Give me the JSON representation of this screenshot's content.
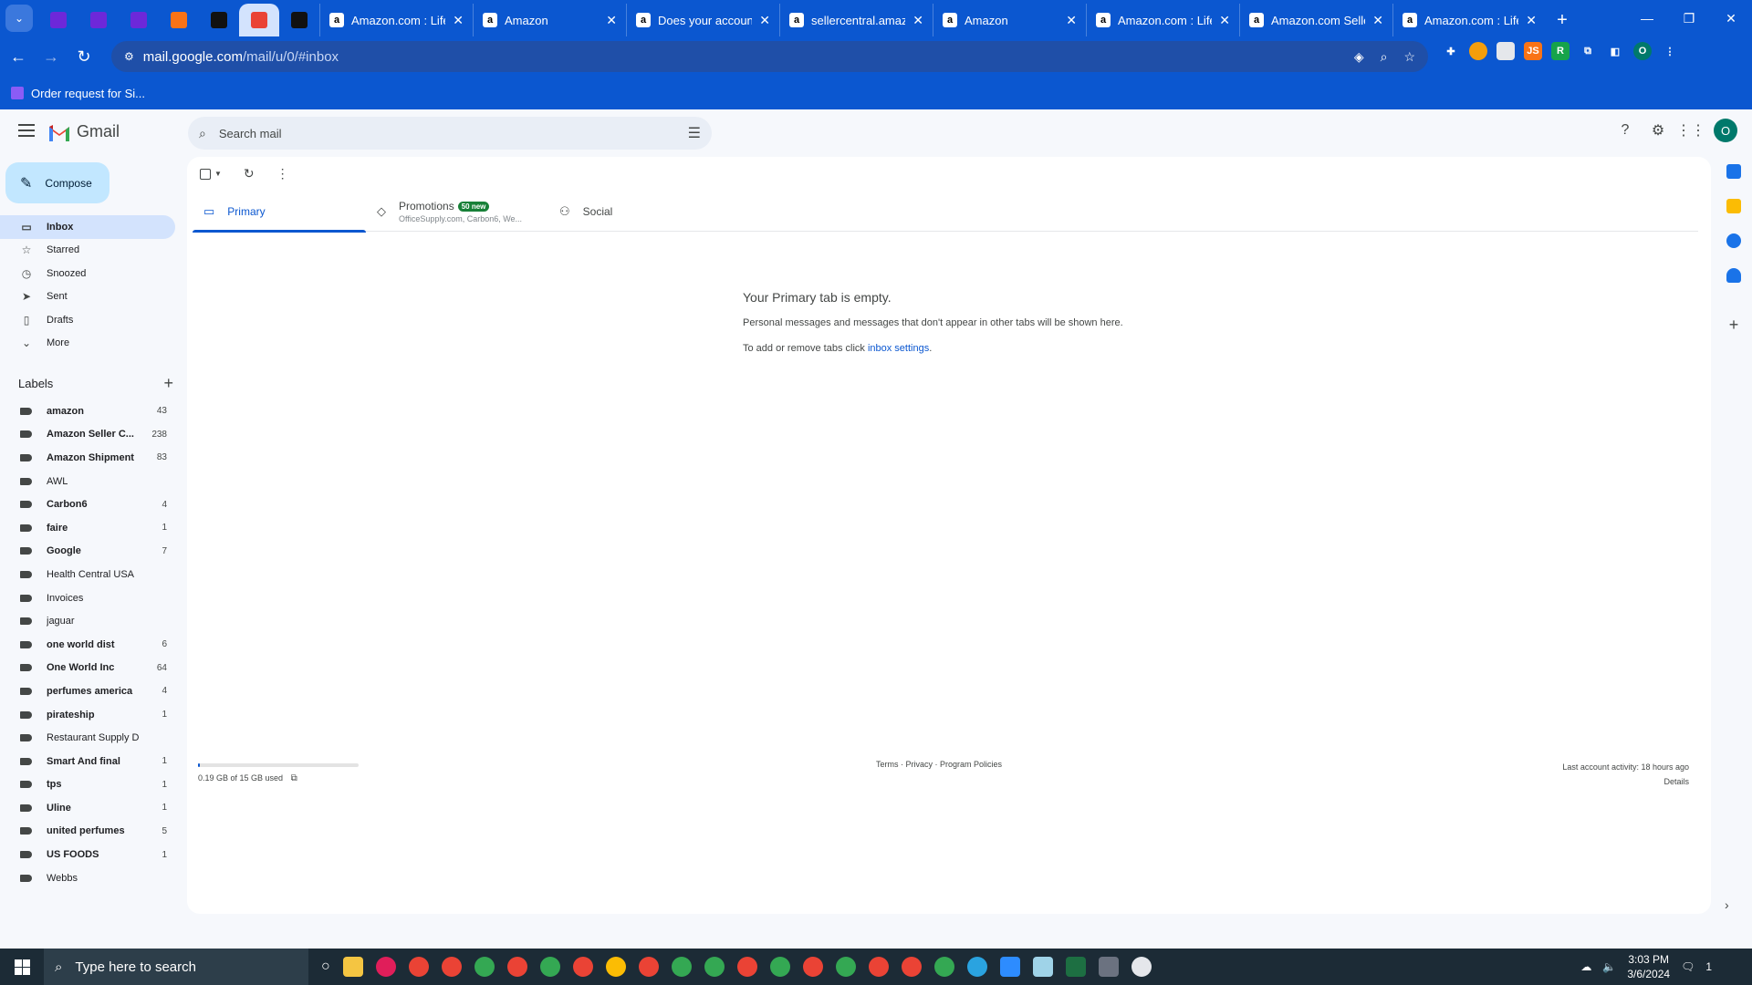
{
  "browser": {
    "pinned_tabs": [
      {
        "name": "purple-app-1",
        "color": "#6d28d9"
      },
      {
        "name": "purple-app-2",
        "color": "#6d28d9"
      },
      {
        "name": "purple-app-3",
        "color": "#6d28d9"
      },
      {
        "name": "clickup",
        "color": "#f97316"
      },
      {
        "name": "amazon",
        "color": "#111111"
      },
      {
        "name": "gmail",
        "color": "#ea4335"
      },
      {
        "name": "amazon",
        "color": "#111111"
      }
    ],
    "tabs": [
      {
        "title": "Amazon.com : Life"
      },
      {
        "title": "Amazon"
      },
      {
        "title": "Does your account"
      },
      {
        "title": "sellercentral.amaz"
      },
      {
        "title": "Amazon"
      },
      {
        "title": "Amazon.com : Life"
      },
      {
        "title": "Amazon.com Selle"
      },
      {
        "title": "Amazon.com : Life"
      }
    ],
    "url_host": "mail.google.com",
    "url_path": "/mail/u/0/#inbox",
    "bookmark": "Order request for Si..."
  },
  "gmail": {
    "logo_text": "Gmail",
    "search_placeholder": "Search mail",
    "avatar_letter": "O",
    "compose_label": "Compose",
    "nav": [
      {
        "label": "Inbox",
        "icon": "inbox-icon",
        "glyph": "▭",
        "active": true
      },
      {
        "label": "Starred",
        "icon": "star-icon",
        "glyph": "☆"
      },
      {
        "label": "Snoozed",
        "icon": "clock-icon",
        "glyph": "◷"
      },
      {
        "label": "Sent",
        "icon": "send-icon",
        "glyph": "➤"
      },
      {
        "label": "Drafts",
        "icon": "draft-icon",
        "glyph": "▯"
      },
      {
        "label": "More",
        "icon": "chevron-down-icon",
        "glyph": "⌄"
      }
    ],
    "labels_heading": "Labels",
    "labels": [
      {
        "name": "amazon",
        "count": "43",
        "bold": true
      },
      {
        "name": "Amazon Seller C...",
        "count": "238",
        "bold": true
      },
      {
        "name": "Amazon Shipment",
        "count": "83",
        "bold": true
      },
      {
        "name": "AWL",
        "count": "",
        "bold": false
      },
      {
        "name": "Carbon6",
        "count": "4",
        "bold": true
      },
      {
        "name": "faire",
        "count": "1",
        "bold": true
      },
      {
        "name": "Google",
        "count": "7",
        "bold": true
      },
      {
        "name": "Health Central USA",
        "count": "",
        "bold": false
      },
      {
        "name": "Invoices",
        "count": "",
        "bold": false
      },
      {
        "name": "jaguar",
        "count": "",
        "bold": false
      },
      {
        "name": "one world dist",
        "count": "6",
        "bold": true
      },
      {
        "name": "One World Inc",
        "count": "64",
        "bold": true
      },
      {
        "name": "perfumes america",
        "count": "4",
        "bold": true
      },
      {
        "name": "pirateship",
        "count": "1",
        "bold": true
      },
      {
        "name": "Restaurant Supply D",
        "count": "",
        "bold": false
      },
      {
        "name": "Smart And final",
        "count": "1",
        "bold": true
      },
      {
        "name": "tps",
        "count": "1",
        "bold": true
      },
      {
        "name": "Uline",
        "count": "1",
        "bold": true
      },
      {
        "name": "united perfumes",
        "count": "5",
        "bold": true
      },
      {
        "name": "US FOODS",
        "count": "1",
        "bold": true
      },
      {
        "name": "Webbs",
        "count": "",
        "bold": false
      }
    ],
    "tabs": {
      "primary": "Primary",
      "promotions": "Promotions",
      "promotions_badge": "50 new",
      "promotions_sub": "OfficeSupply.com, Carbon6, We...",
      "social": "Social"
    },
    "empty": {
      "title": "Your Primary tab is empty.",
      "line1": "Personal messages and messages that don't appear in other tabs will be shown here.",
      "line2_prefix": "To add or remove tabs click ",
      "line2_link": "inbox settings",
      "line2_suffix": "."
    },
    "storage": {
      "text": "0.19 GB of 15 GB used",
      "fraction_used": 0.0127
    },
    "footer_links": "Terms · Privacy · Program Policies",
    "activity": "Last account activity: 18 hours ago",
    "details": "Details"
  },
  "taskbar": {
    "search_placeholder": "Type here to search",
    "time": "3:03 PM",
    "date": "3/6/2024",
    "notification_count": "1"
  }
}
